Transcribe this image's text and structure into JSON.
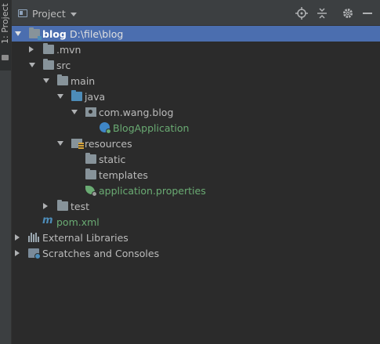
{
  "sidebar": {
    "tab_label": "1: Project"
  },
  "header": {
    "title": "Project"
  },
  "tree": {
    "root": {
      "name": "blog",
      "path": "D:\\file\\blog"
    },
    "mvn": ".mvn",
    "src": "src",
    "main": "main",
    "java": "java",
    "package": "com.wang.blog",
    "app_class": "BlogApplication",
    "resources": "resources",
    "static": "static",
    "templates": "templates",
    "properties": "application.properties",
    "test": "test",
    "pom": "pom.xml",
    "external_libraries": "External Libraries",
    "scratches": "Scratches and Consoles"
  },
  "colors": {
    "selection": "#4b6eaf",
    "spring_green": "#6aab73",
    "folder_blue": "#4d8cb8"
  },
  "icons": [
    "project-view-icon",
    "locate-icon",
    "collapse-all-icon",
    "gear-icon",
    "hide-icon"
  ]
}
